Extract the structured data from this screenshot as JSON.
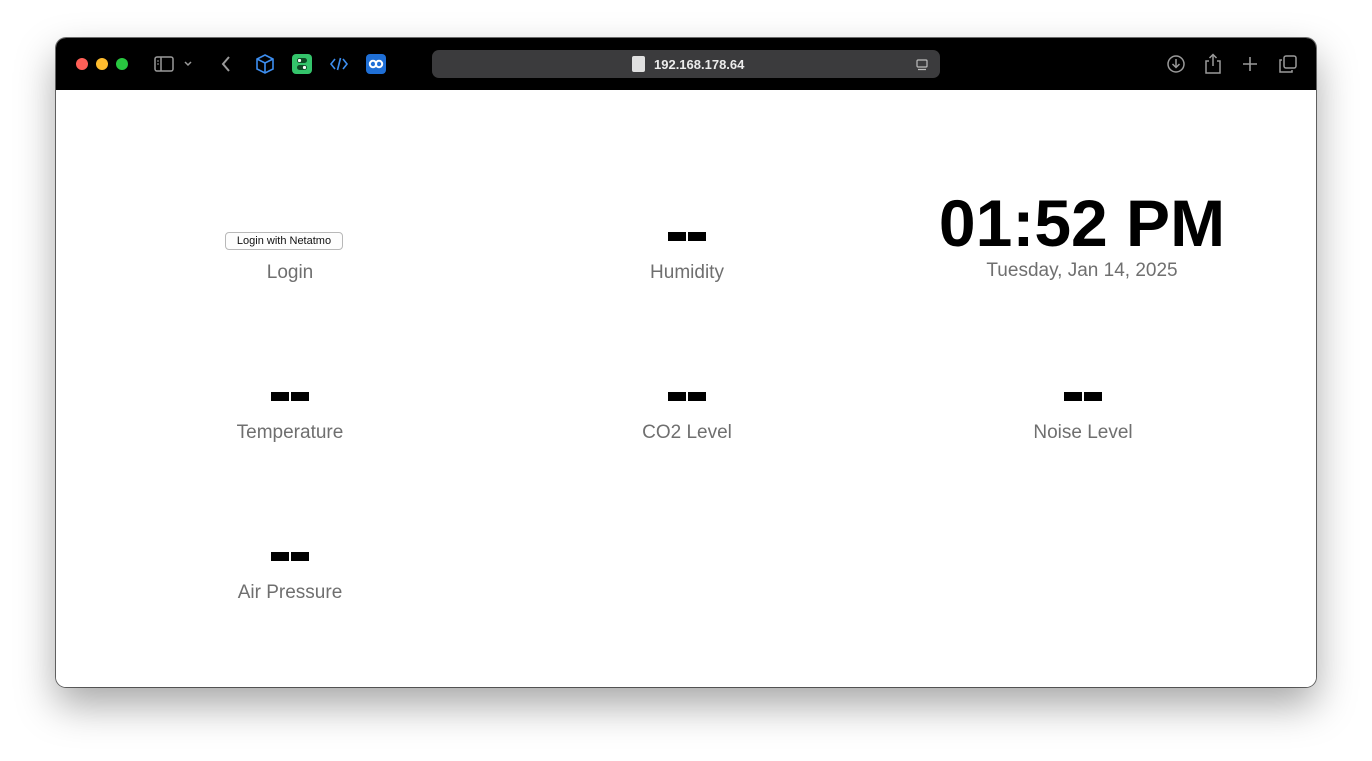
{
  "browser": {
    "address": "192.168.178.64",
    "icons": [
      "sidebar-icon",
      "chevron-down-icon",
      "back-icon",
      "box-extension-icon",
      "green-extension-icon",
      "code-extension-icon",
      "link-extension-icon",
      "reader-icon",
      "download-icon",
      "share-icon",
      "new-tab-icon",
      "tabs-overview-icon"
    ],
    "colors": {
      "close": "#ff5f57",
      "minimize": "#febc2e",
      "zoom": "#28c840"
    }
  },
  "dashboard": {
    "login": {
      "button_label": "Login with Netatmo",
      "label": "Login"
    },
    "humidity": {
      "value": "--",
      "label": "Humidity"
    },
    "clock": {
      "time": "01:52 PM",
      "date": "Tuesday, Jan 14, 2025"
    },
    "temperature": {
      "value": "--",
      "label": "Temperature"
    },
    "co2": {
      "value": "--",
      "label": "CO2 Level"
    },
    "noise": {
      "value": "--",
      "label": "Noise Level"
    },
    "pressure": {
      "value": "--",
      "label": "Air Pressure"
    }
  }
}
